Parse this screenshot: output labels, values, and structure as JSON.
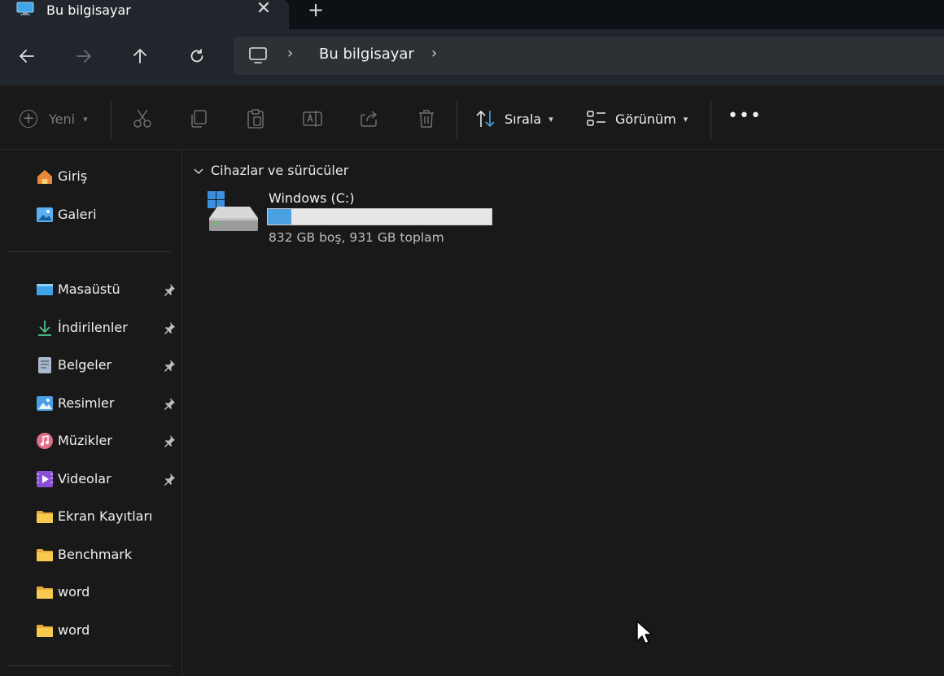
{
  "tab": {
    "title": "Bu bilgisayar",
    "close": "✕",
    "new": "+"
  },
  "address": {
    "location": "Bu bilgisayar",
    "separator": "›"
  },
  "toolbar": {
    "new_label": "Yeni",
    "sort_label": "Sırala",
    "view_label": "Görünüm",
    "more_label": "•••",
    "chevron": "⌄"
  },
  "sidebar": {
    "quick": [
      {
        "label": "Giriş",
        "icon": "home-icon"
      },
      {
        "label": "Galeri",
        "icon": "gallery-icon"
      }
    ],
    "pinned": [
      {
        "label": "Masaüstü",
        "icon": "desktop-icon",
        "pinned": true
      },
      {
        "label": "İndirilenler",
        "icon": "download-icon",
        "pinned": true
      },
      {
        "label": "Belgeler",
        "icon": "documents-icon",
        "pinned": true
      },
      {
        "label": "Resimler",
        "icon": "pictures-icon",
        "pinned": true
      },
      {
        "label": "Müzikler",
        "icon": "music-icon",
        "pinned": true
      },
      {
        "label": "Videolar",
        "icon": "videos-icon",
        "pinned": true
      },
      {
        "label": "Ekran Kayıtları",
        "icon": "folder-icon",
        "pinned": false
      },
      {
        "label": "Benchmark",
        "icon": "folder-icon",
        "pinned": false
      },
      {
        "label": "word",
        "icon": "folder-icon",
        "pinned": false
      },
      {
        "label": "word",
        "icon": "folder-icon",
        "pinned": false
      }
    ]
  },
  "main": {
    "group_title": "Cihazlar ve sürücüler",
    "drive": {
      "name": "Windows (C:)",
      "info": "832 GB boş, 931 GB toplam",
      "used_fraction": 0.106
    }
  },
  "colors": {
    "accent": "#4aa0e0",
    "folder": "#f2c04a",
    "background": "#191919"
  }
}
